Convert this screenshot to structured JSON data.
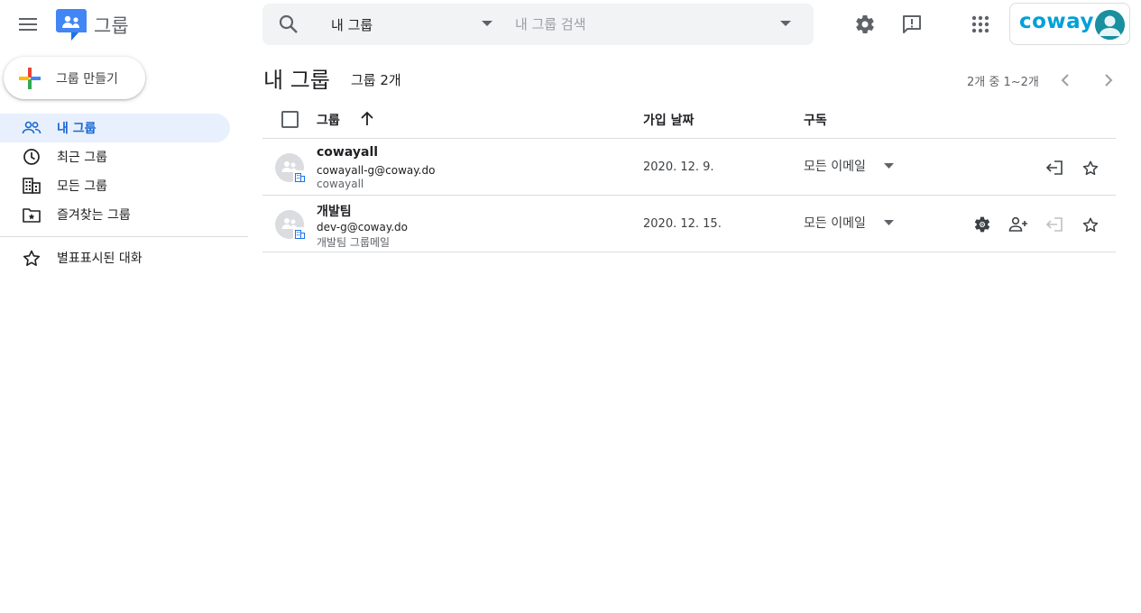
{
  "header": {
    "app_title": "그룹",
    "search": {
      "scope_value": "내 그룹",
      "placeholder": "내 그룹 검색"
    },
    "brand_text": "coway",
    "icons": [
      "menu-icon",
      "search-icon",
      "gear-icon",
      "feedback-icon",
      "apps-grid-icon",
      "account-avatar-icon"
    ]
  },
  "sidebar": {
    "create_label": "그룹 만들기",
    "items": [
      {
        "label": "내 그룹",
        "icon": "people-icon",
        "active": true
      },
      {
        "label": "최근 그룹",
        "icon": "clock-icon",
        "active": false
      },
      {
        "label": "모든 그룹",
        "icon": "building-icon",
        "active": false
      },
      {
        "label": "즐겨찾는 그룹",
        "icon": "folder-star-icon",
        "active": false
      },
      {
        "label": "별표표시된 대화",
        "icon": "star-icon",
        "active": false
      }
    ]
  },
  "main": {
    "title": "내 그룹",
    "group_count": "그룹 2개",
    "pagination": "2개 중 1~2개",
    "columns": {
      "group": "그룹",
      "joined": "가입 날짜",
      "subscription": "구독"
    },
    "rows": [
      {
        "name": "cowayall",
        "email": "cowayall-g@coway.do",
        "description": "cowayall",
        "joined": "2020. 12. 9.",
        "subscription": "모든 이메일",
        "actions": [
          "leave-group-icon",
          "star-icon"
        ]
      },
      {
        "name": "개발팀",
        "email": "dev-g@coway.do",
        "description": "개발팀 그룹메일",
        "joined": "2020. 12. 15.",
        "subscription": "모든 이메일",
        "actions": [
          "gear-icon",
          "add-member-icon",
          "leave-group-icon",
          "star-icon"
        ]
      }
    ]
  },
  "colors": {
    "active_nav_bg": "#e8f0fe",
    "active_nav_text": "#1967d2",
    "brand": "#00a0d8",
    "search_bg": "#f1f3f4"
  }
}
